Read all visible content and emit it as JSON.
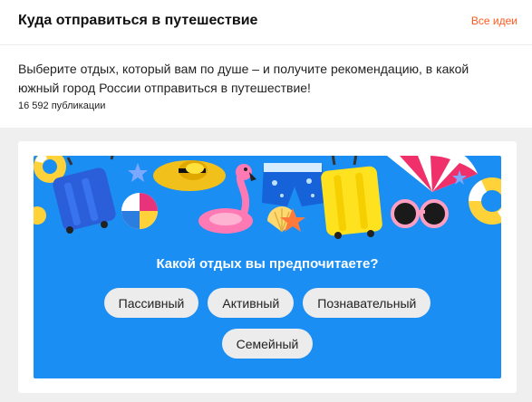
{
  "header": {
    "title": "Куда отправиться в путешествие",
    "all_link": "Все идеи"
  },
  "description": "Выберите отдых, который вам по душе – и получите рекомендацию, в какой южный город России отправиться в путешествие!",
  "publications": "16 592 публикации",
  "quiz": {
    "question": "Какой отдых вы предпочитаете?",
    "options": [
      "Пассивный",
      "Активный",
      "Познавательный",
      "Семейный"
    ]
  },
  "colors": {
    "accent": "#ff5a1f",
    "quiz_bg": "#1b8ef3",
    "option_bg": "#ececec"
  }
}
